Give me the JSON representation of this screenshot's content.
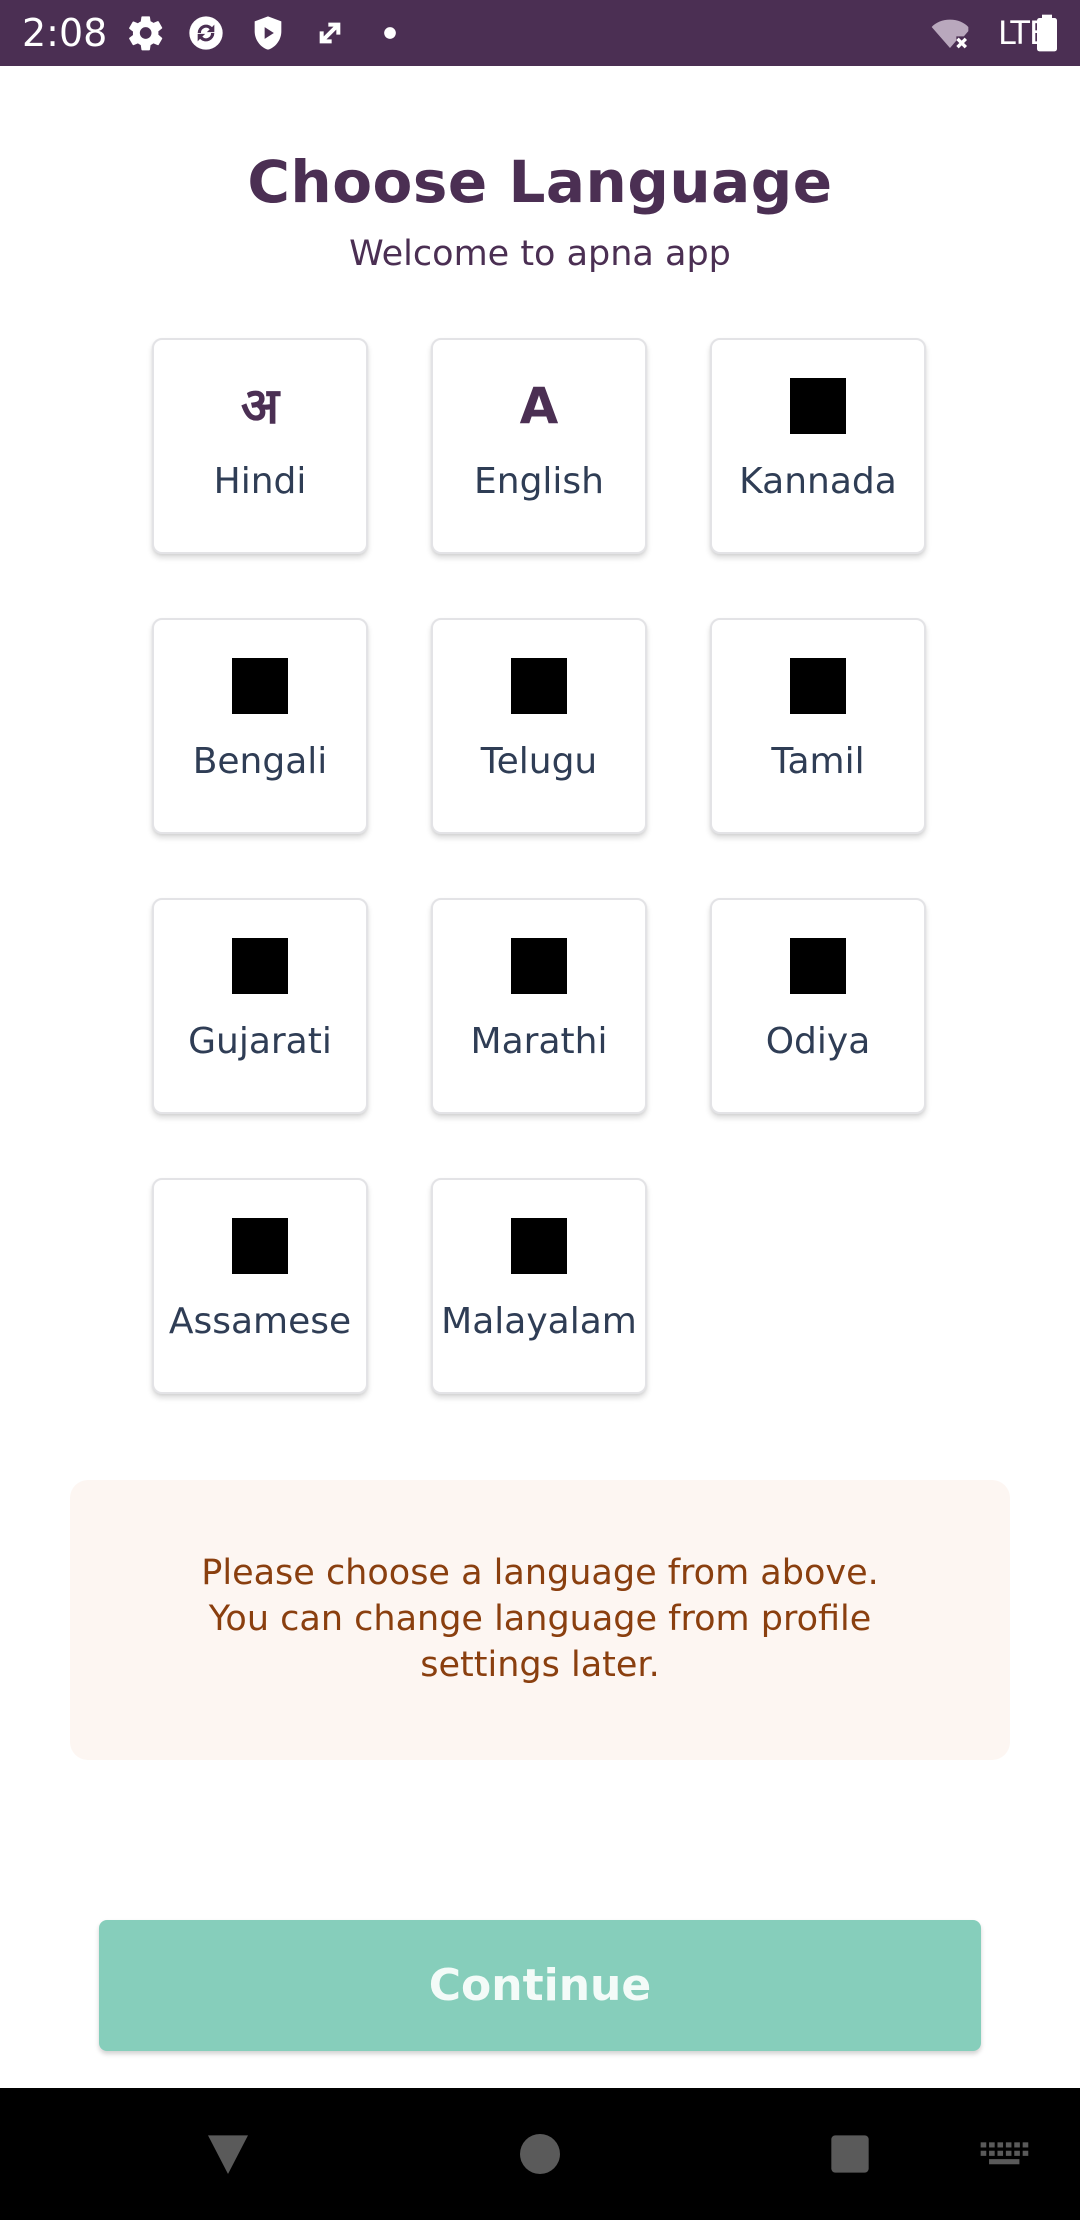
{
  "status_bar": {
    "time": "2:08",
    "network": "LTE",
    "background_color": "#4b2f53",
    "icons": [
      "settings-icon",
      "sync-icon",
      "shield-icon",
      "expand-icon",
      "dot-icon",
      "wifi-off-icon",
      "battery-icon"
    ]
  },
  "header": {
    "title": "Choose Language",
    "subtitle": "Welcome to apna app"
  },
  "languages": [
    {
      "glyph": "अ",
      "label": "Hindi",
      "glyph_style": "text"
    },
    {
      "glyph": "A",
      "label": "English",
      "glyph_style": "text"
    },
    {
      "glyph": "",
      "label": "Kannada",
      "glyph_style": "box"
    },
    {
      "glyph": "",
      "label": "Bengali",
      "glyph_style": "box"
    },
    {
      "glyph": "",
      "label": "Telugu",
      "glyph_style": "box"
    },
    {
      "glyph": "",
      "label": "Tamil",
      "glyph_style": "box"
    },
    {
      "glyph": "",
      "label": "Gujarati",
      "glyph_style": "box"
    },
    {
      "glyph": "",
      "label": "Marathi",
      "glyph_style": "box"
    },
    {
      "glyph": "",
      "label": "Odiya",
      "glyph_style": "box"
    },
    {
      "glyph": "",
      "label": "Assamese",
      "glyph_style": "box"
    },
    {
      "glyph": "",
      "label": "Malayalam",
      "glyph_style": "box"
    }
  ],
  "info": {
    "lines": [
      "Please choose a language from above.",
      "You can change language from profile",
      "settings later."
    ],
    "background_color": "#fdf6f2",
    "text_color": "#8a3f0f"
  },
  "continue_button": {
    "label": "Continue",
    "color": "#86cebb",
    "state": "disabled"
  },
  "nav_bar": {
    "icons": [
      "back-icon",
      "home-icon",
      "recents-icon",
      "keyboard-icon"
    ]
  },
  "colors": {
    "brand": "#4b2f53",
    "card_text": "#2f3d55"
  }
}
